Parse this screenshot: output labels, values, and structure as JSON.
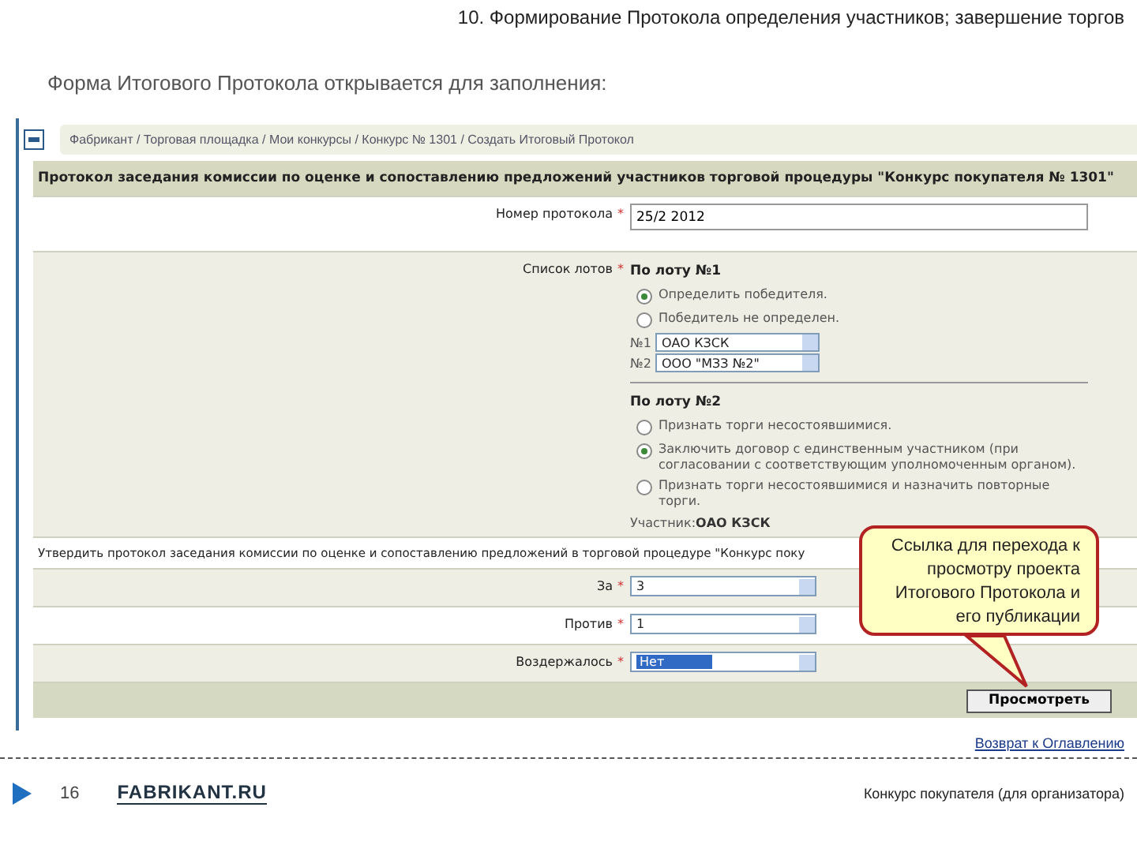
{
  "header": {
    "title": "10. Формирование Протокола определения участников; завершение торгов"
  },
  "intro": "Форма Итогового Протокола открывается для заполнения:",
  "breadcrumb": "Фабрикант / Торговая площадка / Мои конкурсы / Конкурс № 1301 / Создать Итоговый Протокол",
  "form": {
    "title": "Протокол заседания комиссии по оценке и сопоставлению предложений участников торговой процедуры \"Конкурс покупателя № 1301\"",
    "number": {
      "label": "Номер протокола",
      "required_mark": "*",
      "value": "25/2 2012"
    },
    "lots": {
      "label": "Список лотов",
      "required_mark": "*",
      "groups": [
        {
          "heading": "По лоту №1",
          "options": [
            {
              "label": "Определить победителя.",
              "selected": true
            },
            {
              "label": "Победитель не определен.",
              "selected": false
            }
          ],
          "places": [
            {
              "label": "№1",
              "value": "ОАО КЗСК"
            },
            {
              "label": "№2",
              "value": "ООО \"МЗЗ №2\""
            }
          ]
        },
        {
          "heading": "По лоту №2",
          "options": [
            {
              "label": "Признать торги несостоявшимися.",
              "selected": false
            },
            {
              "label": "Заключить договор с единственным участником (при согласовании с соответствующим уполномоченным органом).",
              "selected": true
            },
            {
              "label": "Признать торги несостоявшимися и назначить повторные торги.",
              "selected": false
            }
          ],
          "participant_label": "Участник:",
          "participant": "ОАО КЗСК"
        }
      ]
    },
    "approve": "Утвердить протокол заседания комиссии по оценке и сопоставлению предложений в торговой процедуре \"Конкурс поку",
    "votes": [
      {
        "label": "За",
        "required_mark": "*",
        "value": "3",
        "focused": false
      },
      {
        "label": "Против",
        "required_mark": "*",
        "value": "1",
        "focused": false
      },
      {
        "label": "Воздержалось",
        "required_mark": "*",
        "value": "Нет",
        "focused": true
      }
    ],
    "button": "Просмотреть"
  },
  "callout": "Ссылка для перехода к просмотру проекта Итогового Протокола и его публикации",
  "back_link": "Возврат к Оглавлению",
  "footer": {
    "page": "16",
    "logo": "FABRIKANT.RU",
    "caption": "Конкурс покупателя (для организатора)"
  }
}
